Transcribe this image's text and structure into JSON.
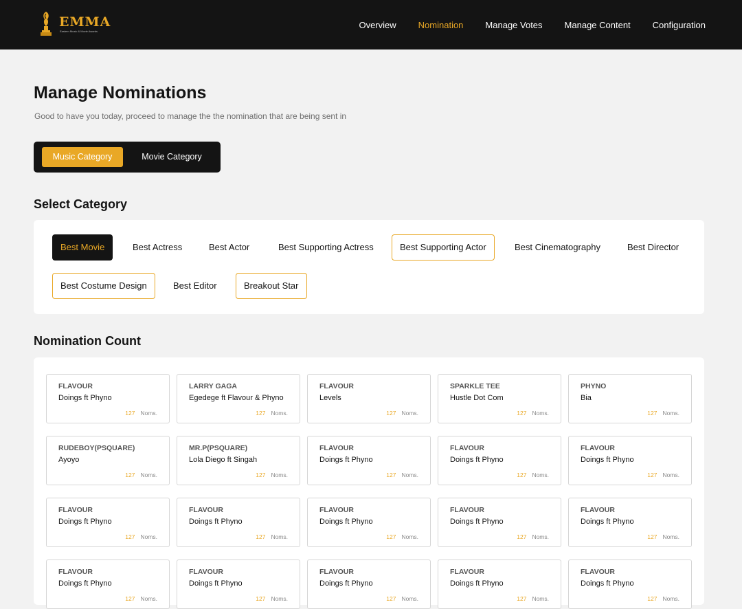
{
  "brand": {
    "name": "EMMA",
    "tagline": "Eastern Music & Movie Awards",
    "color": "#E9A826"
  },
  "nav": {
    "items": [
      {
        "label": "Overview",
        "active": false
      },
      {
        "label": "Nomination",
        "active": true
      },
      {
        "label": "Manage Votes",
        "active": false
      },
      {
        "label": "Manage Content",
        "active": false
      },
      {
        "label": "Configuration",
        "active": false
      }
    ]
  },
  "page": {
    "title": "Manage Nominations",
    "subtitle": "Good to have you today, proceed to manage the the nomination that are being sent in"
  },
  "category_toggle": {
    "music_label": "Music Category",
    "movie_label": "Movie Category",
    "selected": "Music Category"
  },
  "select_category": {
    "title": "Select Category",
    "items": [
      {
        "label": "Best Movie",
        "state": "selected"
      },
      {
        "label": "Best Actress",
        "state": "plain"
      },
      {
        "label": "Best Actor",
        "state": "plain"
      },
      {
        "label": "Best Supporting Actress",
        "state": "plain"
      },
      {
        "label": "Best Supporting Actor",
        "state": "outlined"
      },
      {
        "label": "Best Cinematography",
        "state": "plain"
      },
      {
        "label": "Best Director",
        "state": "plain"
      },
      {
        "label": "Best Costume Design",
        "state": "outlined"
      },
      {
        "label": "Best Editor",
        "state": "plain"
      },
      {
        "label": "Breakout Star",
        "state": "outlined"
      }
    ]
  },
  "nomination_count": {
    "title": "Nomination Count",
    "unit_label": "Noms.",
    "cards": [
      {
        "artist": "FLAVOUR",
        "song": "Doings ft Phyno",
        "count": "127"
      },
      {
        "artist": "LARRY GAGA",
        "song": "Egedege ft Flavour & Phyno",
        "count": "127"
      },
      {
        "artist": "FLAVOUR",
        "song": "Levels",
        "count": "127"
      },
      {
        "artist": "SPARKLE TEE",
        "song": "Hustle Dot Com",
        "count": "127"
      },
      {
        "artist": "PHYNO",
        "song": "Bia",
        "count": "127"
      },
      {
        "artist": "RUDEBOY(PSQUARE)",
        "song": "Ayoyo",
        "count": "127"
      },
      {
        "artist": "MR.P(PSQUARE)",
        "song": "Lola Diego ft Singah",
        "count": "127"
      },
      {
        "artist": "FLAVOUR",
        "song": "Doings ft Phyno",
        "count": "127"
      },
      {
        "artist": "FLAVOUR",
        "song": "Doings ft Phyno",
        "count": "127"
      },
      {
        "artist": "FLAVOUR",
        "song": "Doings ft Phyno",
        "count": "127"
      },
      {
        "artist": "FLAVOUR",
        "song": "Doings ft Phyno",
        "count": "127"
      },
      {
        "artist": "FLAVOUR",
        "song": "Doings ft Phyno",
        "count": "127"
      },
      {
        "artist": "FLAVOUR",
        "song": "Doings ft Phyno",
        "count": "127"
      },
      {
        "artist": "FLAVOUR",
        "song": "Doings ft Phyno",
        "count": "127"
      },
      {
        "artist": "FLAVOUR",
        "song": "Doings ft Phyno",
        "count": "127"
      },
      {
        "artist": "FLAVOUR",
        "song": "Doings ft Phyno",
        "count": "127"
      },
      {
        "artist": "FLAVOUR",
        "song": "Doings ft Phyno",
        "count": "127"
      },
      {
        "artist": "FLAVOUR",
        "song": "Doings ft Phyno",
        "count": "127"
      },
      {
        "artist": "FLAVOUR",
        "song": "Doings ft Phyno",
        "count": "127"
      },
      {
        "artist": "FLAVOUR",
        "song": "Doings ft Phyno",
        "count": "127"
      }
    ]
  },
  "colors": {
    "accent": "#E9A826",
    "dark": "#141414",
    "background": "#F2F2F2"
  }
}
